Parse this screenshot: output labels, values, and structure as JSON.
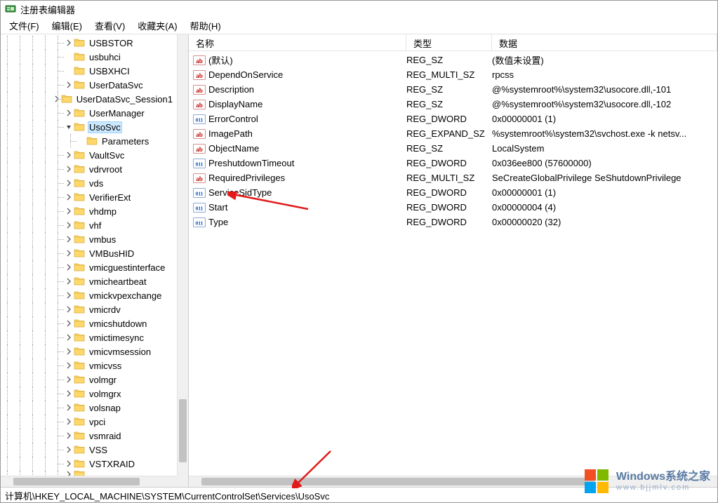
{
  "window": {
    "title": "注册表编辑器"
  },
  "menubar": {
    "file": "文件(F)",
    "edit": "编辑(E)",
    "view": "查看(V)",
    "favorites": "收藏夹(A)",
    "help": "帮助(H)"
  },
  "tree": [
    {
      "depth": 5,
      "exp": ">",
      "label": "USBSTOR"
    },
    {
      "depth": 5,
      "exp": "",
      "label": "usbuhci"
    },
    {
      "depth": 5,
      "exp": "",
      "label": "USBXHCI"
    },
    {
      "depth": 5,
      "exp": ">",
      "label": "UserDataSvc"
    },
    {
      "depth": 5,
      "exp": ">",
      "label": "UserDataSvc_Session1"
    },
    {
      "depth": 5,
      "exp": ">",
      "label": "UserManager"
    },
    {
      "depth": 5,
      "exp": "v",
      "label": "UsoSvc",
      "selected": true
    },
    {
      "depth": 6,
      "exp": "",
      "label": "Parameters"
    },
    {
      "depth": 5,
      "exp": ">",
      "label": "VaultSvc"
    },
    {
      "depth": 5,
      "exp": ">",
      "label": "vdrvroot"
    },
    {
      "depth": 5,
      "exp": ">",
      "label": "vds"
    },
    {
      "depth": 5,
      "exp": ">",
      "label": "VerifierExt"
    },
    {
      "depth": 5,
      "exp": ">",
      "label": "vhdmp"
    },
    {
      "depth": 5,
      "exp": ">",
      "label": "vhf"
    },
    {
      "depth": 5,
      "exp": ">",
      "label": "vmbus"
    },
    {
      "depth": 5,
      "exp": ">",
      "label": "VMBusHID"
    },
    {
      "depth": 5,
      "exp": ">",
      "label": "vmicguestinterface"
    },
    {
      "depth": 5,
      "exp": ">",
      "label": "vmicheartbeat"
    },
    {
      "depth": 5,
      "exp": ">",
      "label": "vmickvpexchange"
    },
    {
      "depth": 5,
      "exp": ">",
      "label": "vmicrdv"
    },
    {
      "depth": 5,
      "exp": ">",
      "label": "vmicshutdown"
    },
    {
      "depth": 5,
      "exp": ">",
      "label": "vmictimesync"
    },
    {
      "depth": 5,
      "exp": ">",
      "label": "vmicvmsession"
    },
    {
      "depth": 5,
      "exp": ">",
      "label": "vmicvss"
    },
    {
      "depth": 5,
      "exp": ">",
      "label": "volmgr"
    },
    {
      "depth": 5,
      "exp": ">",
      "label": "volmgrx"
    },
    {
      "depth": 5,
      "exp": ">",
      "label": "volsnap"
    },
    {
      "depth": 5,
      "exp": ">",
      "label": "vpci"
    },
    {
      "depth": 5,
      "exp": ">",
      "label": "vsmraid"
    },
    {
      "depth": 5,
      "exp": ">",
      "label": "VSS"
    },
    {
      "depth": 5,
      "exp": ">",
      "label": "VSTXRAID"
    },
    {
      "depth": 5,
      "exp": ">",
      "label": "...",
      "cutoff": true
    }
  ],
  "list": {
    "headers": {
      "name": "名称",
      "type": "类型",
      "data": "数据"
    },
    "rows": [
      {
        "icon": "str",
        "name": "(默认)",
        "type": "REG_SZ",
        "data": "(数值未设置)"
      },
      {
        "icon": "str",
        "name": "DependOnService",
        "type": "REG_MULTI_SZ",
        "data": "rpcss"
      },
      {
        "icon": "str",
        "name": "Description",
        "type": "REG_SZ",
        "data": "@%systemroot%\\system32\\usocore.dll,-101"
      },
      {
        "icon": "str",
        "name": "DisplayName",
        "type": "REG_SZ",
        "data": "@%systemroot%\\system32\\usocore.dll,-102"
      },
      {
        "icon": "bin",
        "name": "ErrorControl",
        "type": "REG_DWORD",
        "data": "0x00000001 (1)"
      },
      {
        "icon": "str",
        "name": "ImagePath",
        "type": "REG_EXPAND_SZ",
        "data": "%systemroot%\\system32\\svchost.exe -k netsv..."
      },
      {
        "icon": "str",
        "name": "ObjectName",
        "type": "REG_SZ",
        "data": "LocalSystem"
      },
      {
        "icon": "bin",
        "name": "PreshutdownTimeout",
        "type": "REG_DWORD",
        "data": "0x036ee800 (57600000)"
      },
      {
        "icon": "str",
        "name": "RequiredPrivileges",
        "type": "REG_MULTI_SZ",
        "data": "SeCreateGlobalPrivilege SeShutdownPrivilege"
      },
      {
        "icon": "bin",
        "name": "ServiceSidType",
        "type": "REG_DWORD",
        "data": "0x00000001 (1)"
      },
      {
        "icon": "bin",
        "name": "Start",
        "type": "REG_DWORD",
        "data": "0x00000004 (4)",
        "selected": true
      },
      {
        "icon": "bin",
        "name": "Type",
        "type": "REG_DWORD",
        "data": "0x00000020 (32)"
      }
    ]
  },
  "statusbar": {
    "path": "计算机\\HKEY_LOCAL_MACHINE\\SYSTEM\\CurrentControlSet\\Services\\UsoSvc"
  },
  "watermark": {
    "line1": "Windows系统之家",
    "line2": "www.bjjmlv.com"
  }
}
